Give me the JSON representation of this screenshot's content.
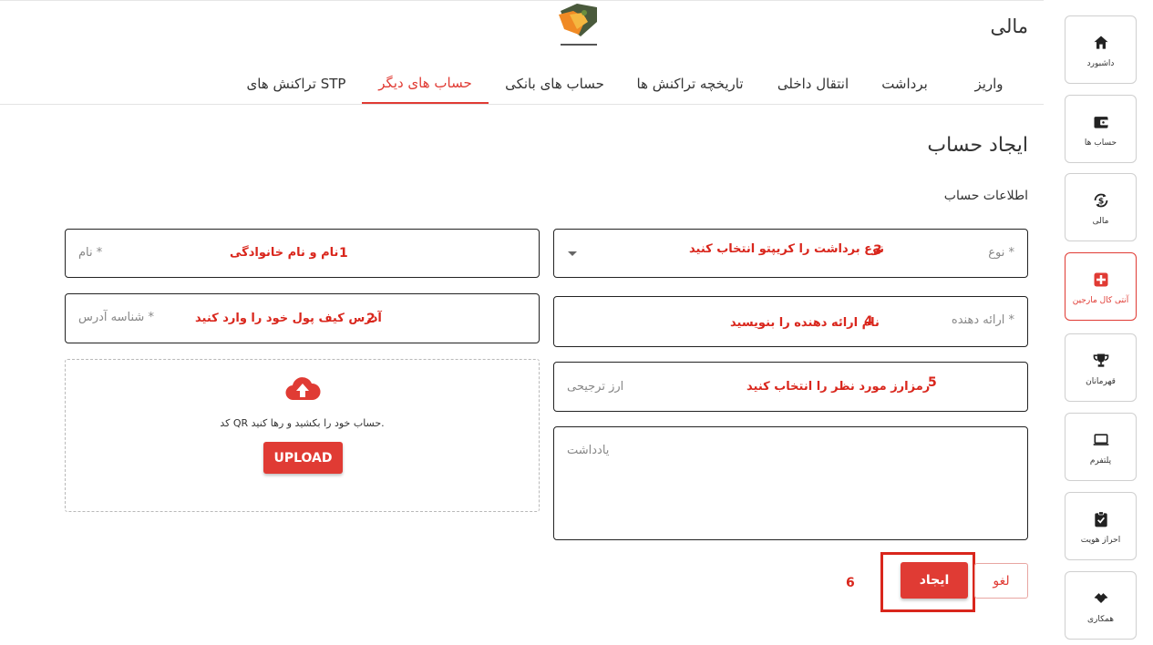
{
  "app": {
    "heading": "مالی",
    "brand_color": "#e03b34"
  },
  "sidebar": {
    "items": [
      {
        "label": "داشبورد",
        "icon": "home-icon"
      },
      {
        "label": "حساب ها",
        "icon": "wallet-icon"
      },
      {
        "label": "مالی",
        "icon": "currency-exchange-icon"
      },
      {
        "label": "آنتی کال مارجین",
        "icon": "medical-cross-icon",
        "active": true
      },
      {
        "label": "قهرمانان",
        "icon": "trophy-icon"
      },
      {
        "label": "پلتفرم",
        "icon": "laptop-icon"
      },
      {
        "label": "احراز هویت",
        "icon": "clipboard-check-icon"
      },
      {
        "label": "همکاری",
        "icon": "handshake-icon"
      }
    ]
  },
  "tabs": [
    {
      "label": "واریز"
    },
    {
      "label": "برداشت"
    },
    {
      "label": "انتقال داخلی"
    },
    {
      "label": "تاریخچه تراکنش ها"
    },
    {
      "label": "حساب های بانکی"
    },
    {
      "label": "حساب های دیگر",
      "active": true
    },
    {
      "label": "تراکنش های STP"
    }
  ],
  "form": {
    "title": "ایجاد حساب",
    "subtitle": "اطلاعات حساب",
    "name": {
      "placeholder": "نام *",
      "annotation": "نام و نام خانوادگی",
      "number": "1"
    },
    "address": {
      "placeholder": "شناسه آدرس *",
      "annotation": "آدرس کیف پول خود را وارد کنید",
      "number": "2"
    },
    "type": {
      "placeholder": "نوع *",
      "annotation": "نوع برداشت را کریپتو انتخاب کنید",
      "number": "3"
    },
    "provider": {
      "placeholder": "ارائه دهنده *",
      "annotation": "نام ارائه دهنده را بنویسید",
      "number": "4"
    },
    "currency": {
      "placeholder": "ارز ترجیحی",
      "annotation": "رمزارز مورد نظر را انتخاب کنید",
      "number": "5"
    },
    "note": {
      "placeholder": "یادداشت"
    },
    "upload": {
      "text": "کد QR حساب خود را بکشید و رها کنید.",
      "button": "UPLOAD",
      "icon": "cloud-upload-icon"
    },
    "create_button": "ایجاد",
    "cancel_button": "لغو",
    "create_number": "6"
  }
}
